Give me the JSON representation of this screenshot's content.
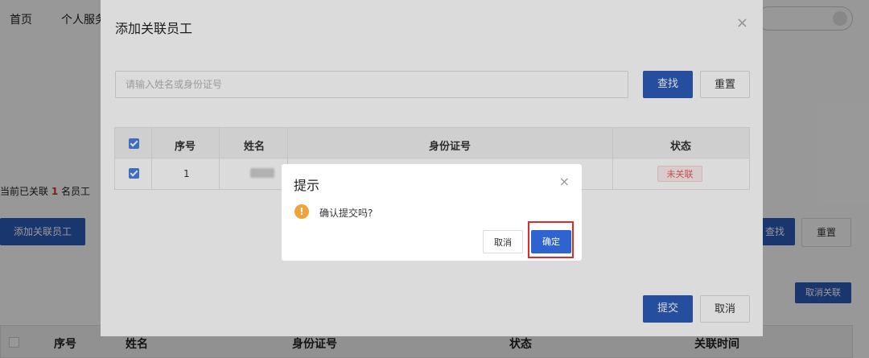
{
  "nav": {
    "home": "首页",
    "personal": "个人服务"
  },
  "background": {
    "linked_prefix": "当前已关联",
    "linked_count": "1",
    "linked_suffix": "名员工",
    "add_button": "添加关联员工",
    "search_button": "查找",
    "reset_button": "重置",
    "unlink_button": "取消关联",
    "table_headers": [
      "序号",
      "姓名",
      "身份证号",
      "状态",
      "关联时间"
    ]
  },
  "dialog": {
    "title": "添加关联员工",
    "close": "×",
    "search_placeholder": "请输入姓名或身份证号",
    "search_button": "查找",
    "reset_button": "重置",
    "table": {
      "headers": [
        "序号",
        "姓名",
        "身份证号",
        "状态"
      ],
      "rows": [
        {
          "index": "1",
          "name": "",
          "id_number": "",
          "status": "未关联"
        }
      ]
    },
    "submit_button": "提交",
    "cancel_button": "取消"
  },
  "confirm": {
    "title": "提示",
    "close": "×",
    "message": "确认提交吗?",
    "cancel_button": "取消",
    "ok_button": "确定"
  },
  "colors": {
    "primary": "#2d5bb9",
    "warning": "#f0a33a",
    "danger": "#e85d5d",
    "highlight": "#e02a2a"
  }
}
